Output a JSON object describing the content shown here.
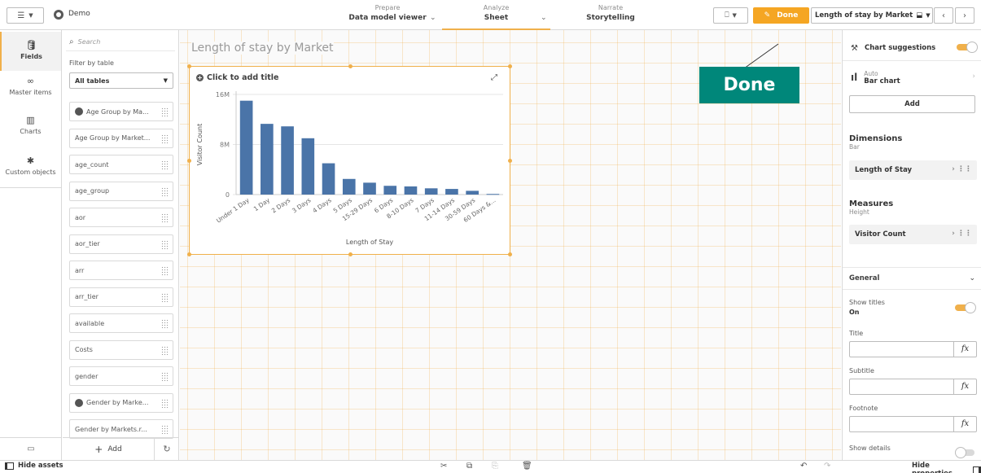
{
  "topbar": {
    "app_name": "Demo",
    "tabs": [
      {
        "small": "Prepare",
        "big": "Data model viewer"
      },
      {
        "small": "Analyze",
        "big": "Sheet"
      },
      {
        "small": "Narrate",
        "big": "Storytelling"
      }
    ],
    "done_label": "Done",
    "sheet_name": "Length of stay by Market"
  },
  "rail": {
    "items": [
      {
        "label": "Fields",
        "icon": "database-icon"
      },
      {
        "label": "Master items",
        "icon": "link-icon"
      },
      {
        "label": "Charts",
        "icon": "chart-icon"
      },
      {
        "label": "Custom objects",
        "icon": "puzzle-icon"
      }
    ]
  },
  "fields": {
    "search_placeholder": "Search",
    "filter_label": "Filter by table",
    "filter_value": "All tables",
    "items": [
      {
        "label": "Age Group by Ma...",
        "globe": true
      },
      {
        "label": "Age Group by Market...",
        "globe": false
      },
      {
        "label": "age_count",
        "globe": false
      },
      {
        "label": "age_group",
        "globe": false
      },
      {
        "label": "aor",
        "globe": false
      },
      {
        "label": "aor_tier",
        "globe": false
      },
      {
        "label": "arr",
        "globe": false
      },
      {
        "label": "arr_tier",
        "globe": false
      },
      {
        "label": "available",
        "globe": false
      },
      {
        "label": "Costs",
        "globe": false
      },
      {
        "label": "gender",
        "globe": false
      },
      {
        "label": "Gender by Marke...",
        "globe": true
      },
      {
        "label": "Gender by Markets.r...",
        "globe": false
      }
    ],
    "add_label": "Add"
  },
  "sheet": {
    "title": "Length of stay by Market",
    "chart_title_placeholder": "Click to add title"
  },
  "callout": {
    "label": "Done"
  },
  "chart_data": {
    "type": "bar",
    "title": "",
    "xlabel": "Length of Stay",
    "ylabel": "Visitor Count",
    "ylim": [
      0,
      16000000
    ],
    "yticks": [
      "16M",
      "8M",
      "0"
    ],
    "categories": [
      "Under 1 Day",
      "1 Day",
      "2 Days",
      "3 Days",
      "4 Days",
      "5 Days",
      "15-29 Days",
      "6 Days",
      "8-10 Days",
      "7 Days",
      "11-14 Days",
      "30-59 Days",
      "60 Days &..."
    ],
    "values": [
      15000000,
      11300000,
      10900000,
      9000000,
      5000000,
      2500000,
      1900000,
      1400000,
      1300000,
      1000000,
      900000,
      600000,
      100000
    ],
    "bar_color": "#4a74a8"
  },
  "props": {
    "chart_suggestions": "Chart suggestions",
    "auto_label": "Auto",
    "chart_type": "Bar chart",
    "add_label": "Add",
    "dimensions_title": "Dimensions",
    "dimensions_sub": "Bar",
    "dimension_value": "Length of Stay",
    "measures_title": "Measures",
    "measures_sub": "Height",
    "measure_value": "Visitor Count",
    "general_label": "General",
    "show_titles_label": "Show titles",
    "show_titles_value": "On",
    "title_label": "Title",
    "subtitle_label": "Subtitle",
    "footnote_label": "Footnote",
    "fx_label": "fx",
    "show_details_label": "Show details"
  },
  "bottombar": {
    "hide_assets": "Hide assets",
    "hide_properties": "Hide properties"
  },
  "colors": {
    "accent": "#f5a623",
    "callout": "#00877a",
    "bar": "#4a74a8"
  }
}
